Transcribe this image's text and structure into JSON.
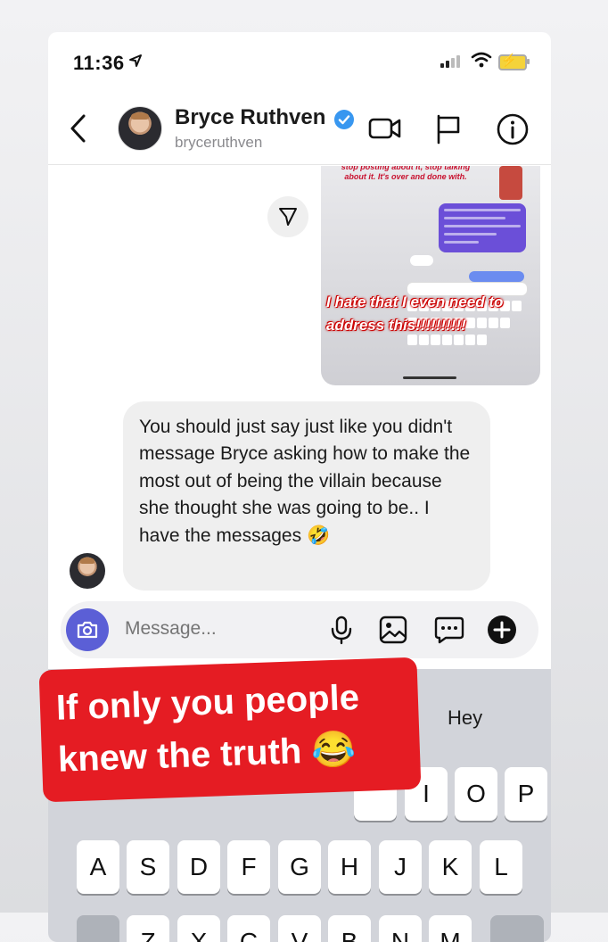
{
  "status_bar": {
    "time": "11:36"
  },
  "header": {
    "name": "Bryce Ruthven",
    "username": "bryceruthven"
  },
  "shared_story": {
    "top_text": "stop posting about it, stop talking about it. It's over and done with.",
    "overlay_text": "I hate that I even need to address this!!!!!!!!!!"
  },
  "message": {
    "text": "You should just say just like you didn't message Bryce asking how to make the most out of being the villain because she thought she was going to be.. I have the messages 🤣"
  },
  "composer": {
    "placeholder": "Message..."
  },
  "keyboard": {
    "suggestion": "Hey",
    "row1": [
      "I",
      "O",
      "P"
    ],
    "row2": [
      "A",
      "S",
      "D",
      "F",
      "G",
      "H",
      "J",
      "K",
      "L"
    ],
    "row3": [
      "Z",
      "X",
      "C",
      "V",
      "B",
      "N",
      "M"
    ]
  },
  "sticker": {
    "text": "If only you people knew the truth 😂"
  },
  "colors": {
    "verified": "#3897f0",
    "camera_button": "#5b5fd6",
    "sticker_red": "#e51c23"
  }
}
